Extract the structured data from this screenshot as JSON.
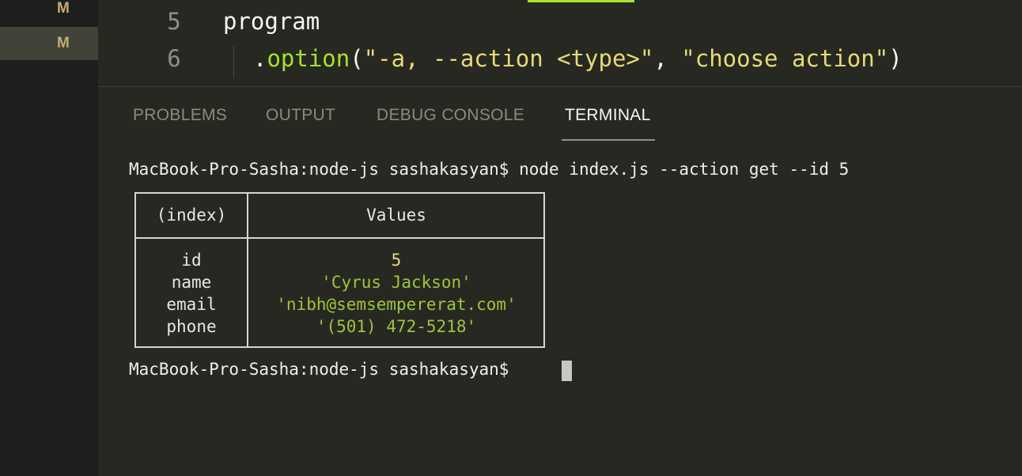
{
  "explorer": {
    "items": [
      {
        "status": "M"
      },
      {
        "status": "M"
      }
    ]
  },
  "editor": {
    "lines": [
      {
        "number": "5",
        "text": "program"
      },
      {
        "number": "6",
        "dot": ".",
        "fn": "option",
        "open": "(",
        "arg1": "\"-a, --action <type>\"",
        "comma": ", ",
        "arg2": "\"choose action\"",
        "close": ")"
      }
    ]
  },
  "panel": {
    "tabs": [
      {
        "label": "PROBLEMS"
      },
      {
        "label": "OUTPUT"
      },
      {
        "label": "DEBUG CONSOLE"
      },
      {
        "label": "TERMINAL",
        "active": true
      }
    ]
  },
  "terminal": {
    "command_line": "MacBook-Pro-Sasha:node-js sashakasyan$ node index.js --action get --id 5",
    "table": {
      "headers": [
        "(index)",
        "Values"
      ],
      "rows": [
        {
          "index": "id",
          "value": "5"
        },
        {
          "index": "name",
          "value": "'Cyrus Jackson'"
        },
        {
          "index": "email",
          "value": "'nibh@semsempererat.com'"
        },
        {
          "index": "phone",
          "value": "'(501) 472-5218'"
        }
      ]
    },
    "prompt": "MacBook-Pro-Sasha:node-js sashakasyan$ "
  },
  "colors": {
    "background": "#272822",
    "function": "#a6e22e",
    "string": "#e6db74",
    "git_modified": "#c7aa75"
  }
}
